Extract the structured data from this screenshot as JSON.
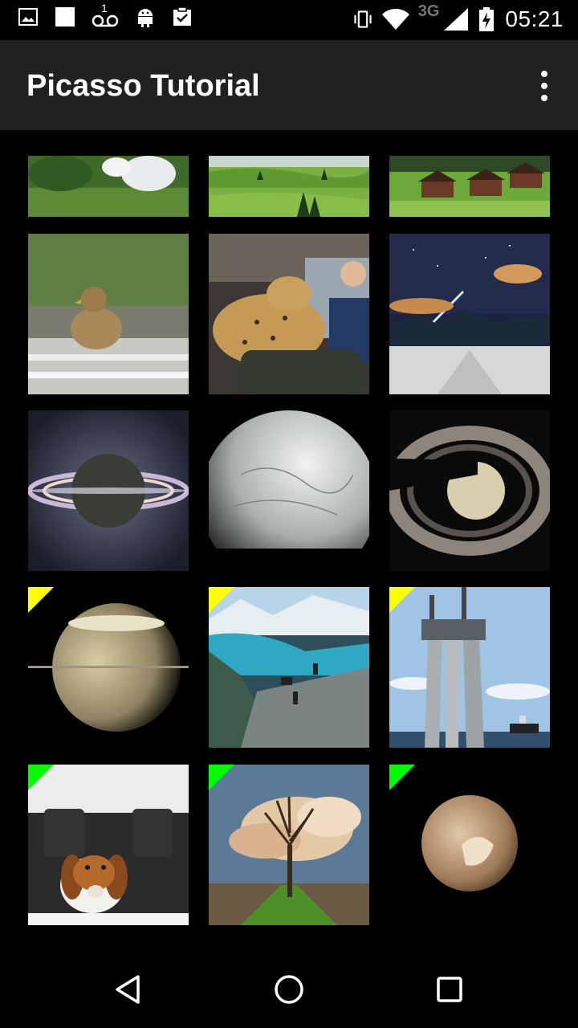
{
  "status_bar": {
    "network": "3G",
    "time": "05:21",
    "voicemail_count": "1",
    "icons_left": [
      "gallery-icon",
      "square-notification-icon",
      "voicemail-icon",
      "android-icon",
      "clipboard-check-icon"
    ],
    "icons_right": [
      "vibrate-icon",
      "wifi-icon",
      "signal-icon",
      "battery-charging-icon"
    ]
  },
  "app_bar": {
    "title": "Picasso Tutorial",
    "overflow_icon": "more-vert-icon"
  },
  "grid": {
    "flag_colors": {
      "yellow": "#FFFF00",
      "green": "#00FF00"
    },
    "images": [
      {
        "subject": "sleeping-dog-on-grass"
      },
      {
        "subject": "green-hills-landscape"
      },
      {
        "subject": "alpine-chalets"
      },
      {
        "subject": "duckling-at-window"
      },
      {
        "subject": "cheetah-in-car"
      },
      {
        "subject": "meteor-over-snowy-road"
      },
      {
        "subject": "saturn-backlit-rings"
      },
      {
        "subject": "icy-moon-enceladus"
      },
      {
        "subject": "saturn-with-shadow"
      },
      {
        "subject": "saturn-crescent",
        "flag": "yellow"
      },
      {
        "subject": "band-on-cliff-fjord",
        "flag": "yellow"
      },
      {
        "subject": "offshore-platform",
        "flag": "yellow"
      },
      {
        "subject": "beagle-in-car",
        "flag": "green"
      },
      {
        "subject": "tree-with-clouds",
        "flag": "green"
      },
      {
        "subject": "pluto",
        "flag": "green"
      }
    ]
  },
  "nav_bar": {
    "back_icon": "back-triangle-icon",
    "home_icon": "home-circle-icon",
    "recents_icon": "recents-square-icon"
  }
}
